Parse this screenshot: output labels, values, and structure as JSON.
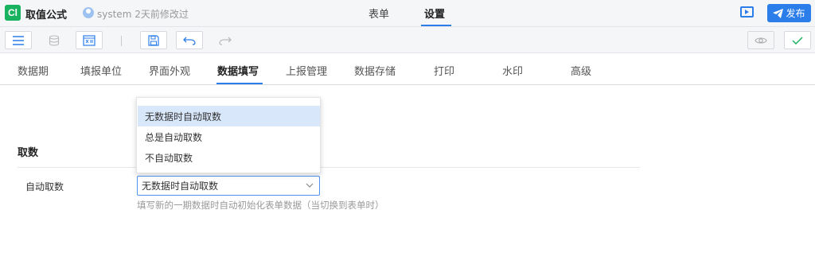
{
  "app": {
    "logo_text": "Cl",
    "title": "取值公式",
    "meta": "system 2天前修改过",
    "publish_label": "发布"
  },
  "top_tabs": [
    {
      "label": "表单",
      "active": false
    },
    {
      "label": "设置",
      "active": true
    }
  ],
  "toolbar": {
    "icons": [
      "menu-icon",
      "database-icon",
      "formula-icon",
      "save-icon",
      "undo-icon",
      "redo-icon",
      "preview-eye-icon",
      "check-icon"
    ]
  },
  "settings_tabs": [
    {
      "label": "数据期",
      "active": false
    },
    {
      "label": "填报单位",
      "active": false
    },
    {
      "label": "界面外观",
      "active": false
    },
    {
      "label": "数据填写",
      "active": true
    },
    {
      "label": "上报管理",
      "active": false
    },
    {
      "label": "数据存储",
      "active": false
    },
    {
      "label": "打印",
      "active": false
    },
    {
      "label": "水印",
      "active": false
    },
    {
      "label": "高级",
      "active": false
    }
  ],
  "section": {
    "title": "取数",
    "field_label": "自动取数",
    "select_value": "无数据时自动取数",
    "hint": "填写新的一期数据时自动初始化表单数据（当切换到表单时）",
    "options": [
      {
        "label": "无数据时自动取数",
        "selected": true
      },
      {
        "label": "总是自动取数",
        "selected": false
      },
      {
        "label": "不自动取数",
        "selected": false
      }
    ]
  },
  "colors": {
    "accent": "#2b7de9",
    "logo_green": "#19b25f",
    "selected_option_bg": "#d9e7fb"
  }
}
